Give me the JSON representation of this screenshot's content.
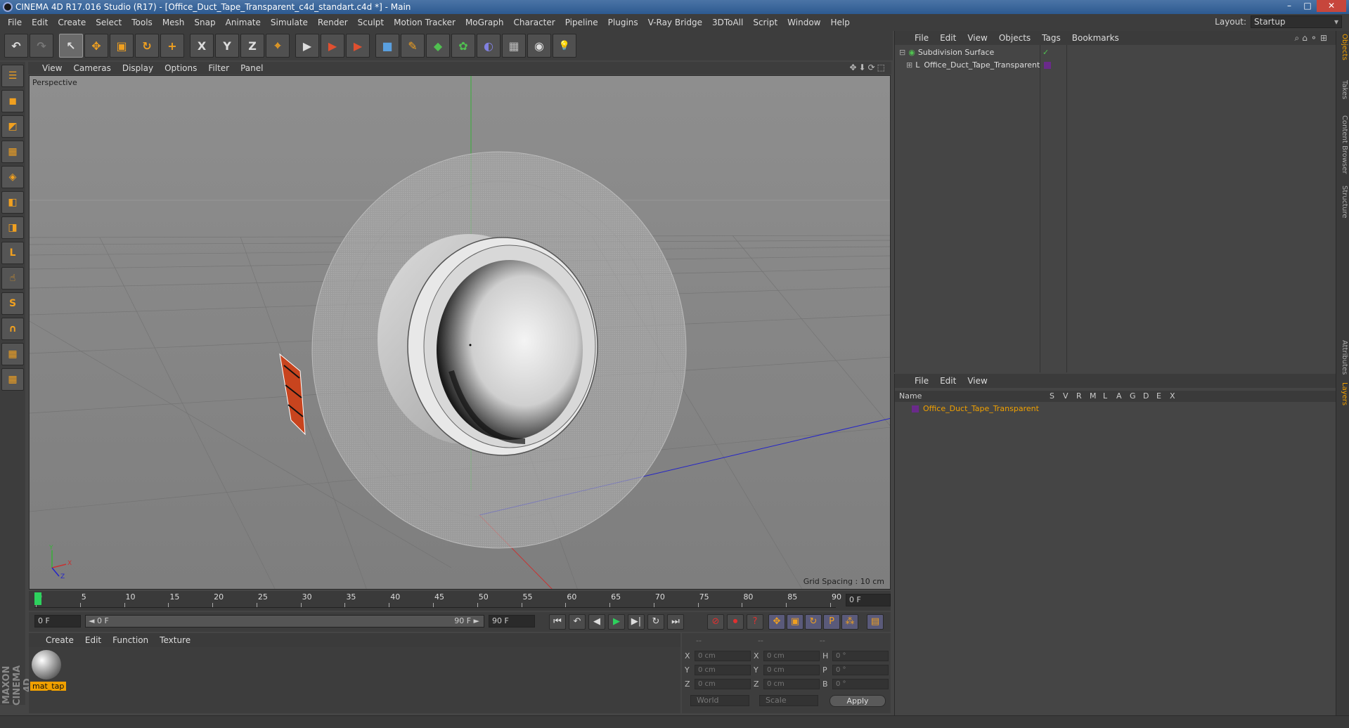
{
  "window": {
    "title": "CINEMA 4D R17.016 Studio (R17) - [Office_Duct_Tape_Transparent_c4d_standart.c4d *] - Main",
    "min": "–",
    "max": "□",
    "close": "✕"
  },
  "menu": [
    "File",
    "Edit",
    "Create",
    "Select",
    "Tools",
    "Mesh",
    "Snap",
    "Animate",
    "Simulate",
    "Render",
    "Sculpt",
    "Motion Tracker",
    "MoGraph",
    "Character",
    "Pipeline",
    "Plugins",
    "V-Ray Bridge",
    "3DToAll",
    "Script",
    "Window",
    "Help"
  ],
  "layout": {
    "label": "Layout:",
    "value": "Startup"
  },
  "toolbar": {
    "undo": "↶",
    "redo": "↷",
    "select": "↖",
    "move": "✥",
    "scale": "▣",
    "rotate": "↻",
    "last": "+",
    "x": "X",
    "y": "Y",
    "z": "Z",
    "coord": "⌖",
    "render1": "▶",
    "render2": "▶",
    "render3": "▶",
    "cube": "■",
    "pen": "✎",
    "nurbs": "◆",
    "array": "✿",
    "deform": "◐",
    "floor": "▦",
    "camera": "◉",
    "light": "💡"
  },
  "left_tools": [
    "☰",
    "◼",
    "◩",
    "▦",
    "◈",
    "◧",
    "◨",
    "L",
    "☝",
    "S",
    "∩",
    "▦",
    "▦"
  ],
  "brand": "MAXON CINEMA 4D",
  "viewport": {
    "menu": [
      "View",
      "Cameras",
      "Display",
      "Options",
      "Filter",
      "Panel"
    ],
    "nav_icons": "✥⬇⟳⬚",
    "label": "Perspective",
    "grid_spacing": "Grid Spacing : 10 cm",
    "axis_y": "Y",
    "axis_x": "X",
    "axis_z": "Z"
  },
  "timeline": {
    "ticks": [
      "0",
      "5",
      "10",
      "15",
      "20",
      "25",
      "30",
      "35",
      "40",
      "45",
      "50",
      "55",
      "60",
      "65",
      "70",
      "75",
      "80",
      "85",
      "90"
    ],
    "current": "0 F"
  },
  "transport": {
    "start": "0 F",
    "range_start": "◄ 0 F",
    "range_end": "90 F ►",
    "end": "90 F",
    "btns": [
      "⏮",
      "↶",
      "◀",
      "▶",
      "▶|",
      "↻",
      "⏭"
    ],
    "rec": [
      "⊘",
      "⏺",
      "?"
    ],
    "keys": [
      "✥",
      "▣",
      "↻",
      "P",
      "⁂",
      "▤"
    ]
  },
  "material": {
    "menu": [
      "Create",
      "Edit",
      "Function",
      "Texture"
    ],
    "name": "mat_tap"
  },
  "coords": {
    "header": [
      "--",
      "--",
      "--"
    ],
    "rows": [
      {
        "a": "X",
        "av": "0 cm",
        "b": "X",
        "bv": "0 cm",
        "c": "H",
        "cv": "0 °"
      },
      {
        "a": "Y",
        "av": "0 cm",
        "b": "Y",
        "bv": "0 cm",
        "c": "P",
        "cv": "0 °"
      },
      {
        "a": "Z",
        "av": "0 cm",
        "b": "Z",
        "bv": "0 cm",
        "c": "B",
        "cv": "0 °"
      }
    ],
    "world": "World",
    "scale": "Scale",
    "apply": "Apply"
  },
  "objects": {
    "menu": [
      "File",
      "Edit",
      "View",
      "Objects",
      "Tags",
      "Bookmarks"
    ],
    "icons": "⌕⌂⚬⊞",
    "items": [
      {
        "name": "Subdivision Surface",
        "check": "✓"
      },
      {
        "name": "Office_Duct_Tape_Transparent"
      }
    ]
  },
  "layers": {
    "menu": [
      "File",
      "Edit",
      "View"
    ],
    "cols": [
      "Name",
      "S",
      "V",
      "R",
      "M",
      "L",
      "A",
      "G",
      "D",
      "E",
      "X"
    ],
    "items": [
      {
        "name": "Office_Duct_Tape_Transparent"
      }
    ]
  },
  "side_tabs": [
    "Objects",
    "Takes",
    "Content Browser",
    "Structure",
    "Attributes",
    "Layers"
  ],
  "colors": {
    "accent": "#f0a000",
    "selected_layer": "#f0a000",
    "green_axis": "#37b037",
    "blue_axis": "#2424c8",
    "red_axis": "#c83232"
  }
}
